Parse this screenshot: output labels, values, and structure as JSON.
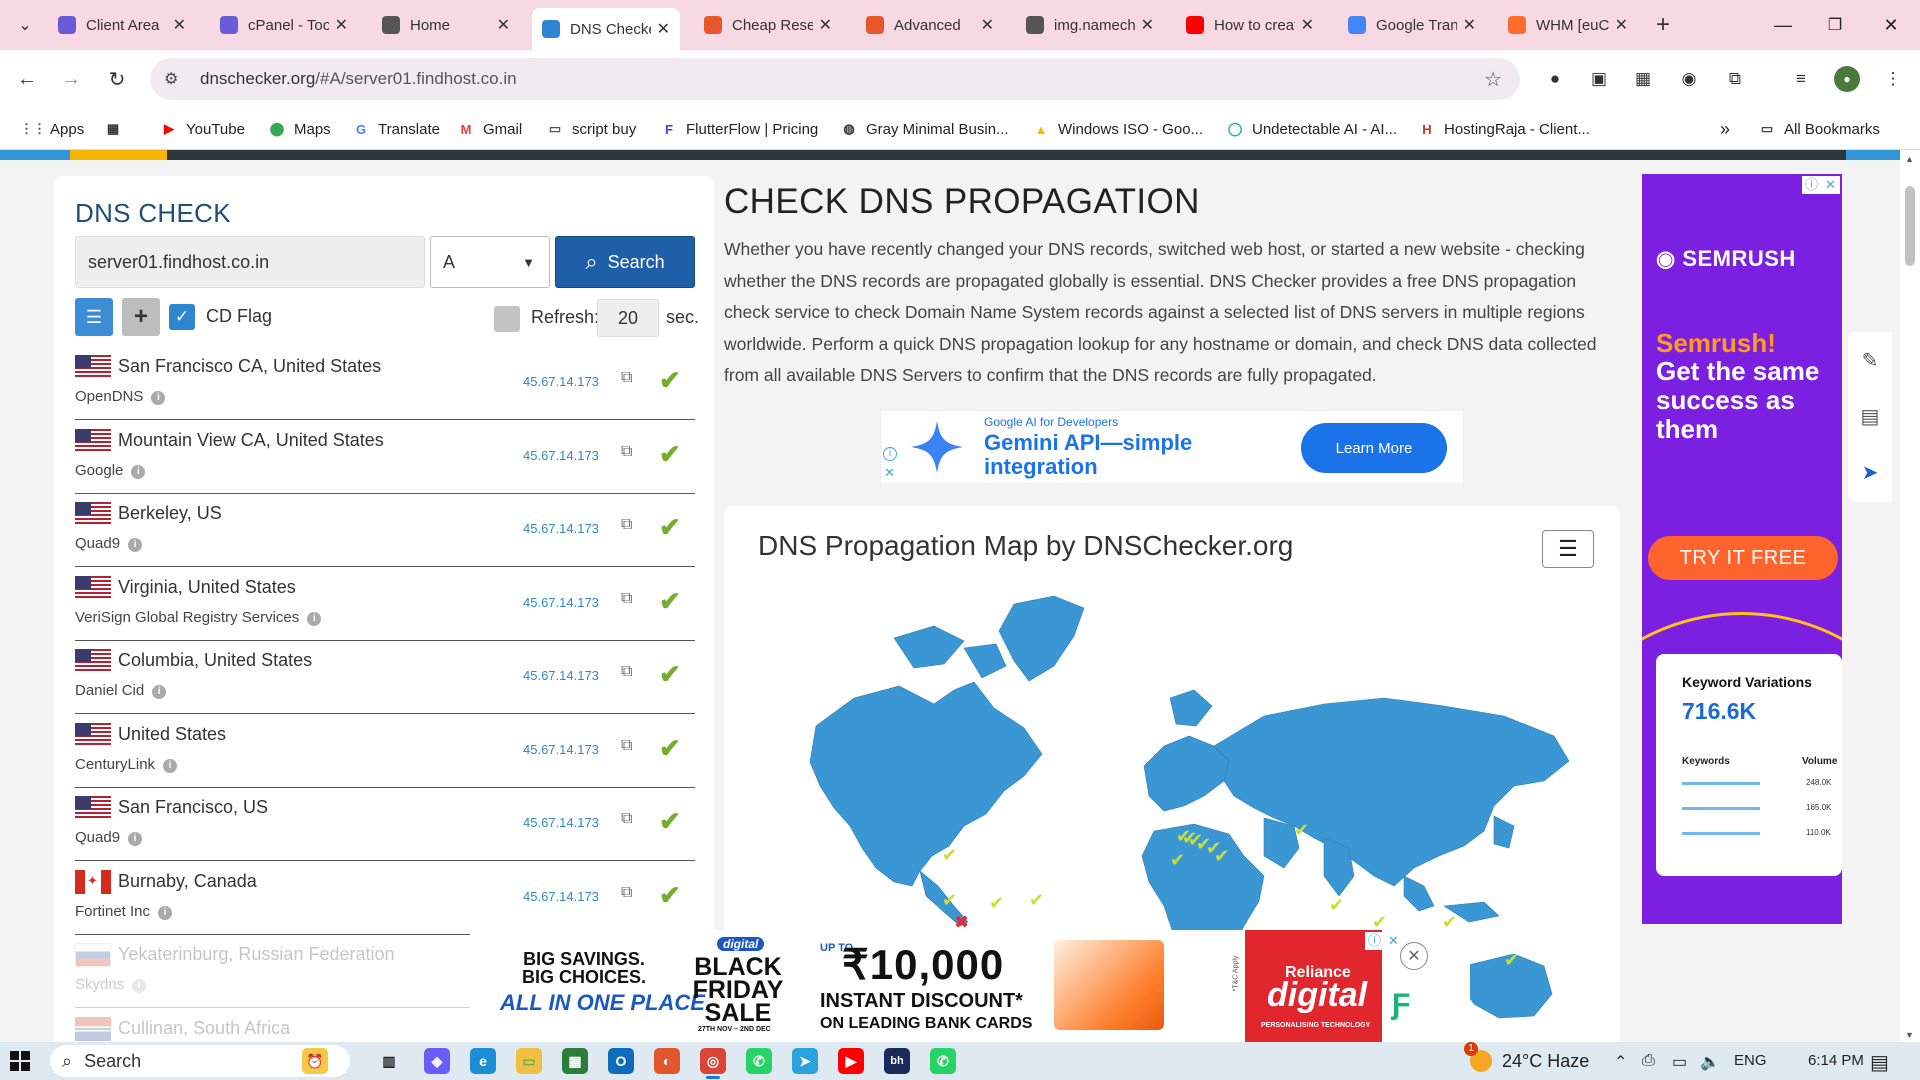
{
  "browser": {
    "tabs": [
      {
        "label": "Client Area",
        "icon": "globe-icon",
        "color": "#6b5bd6",
        "active": false
      },
      {
        "label": "cPanel - Tools",
        "icon": "cpanel-icon",
        "color": "#6b5bd6",
        "active": false
      },
      {
        "label": "Home",
        "icon": "globe-icon",
        "color": "#555555",
        "active": false
      },
      {
        "label": "DNS Checker",
        "icon": "dnschecker-icon",
        "color": "#2f86d0",
        "active": true
      },
      {
        "label": "Cheap Reseller",
        "icon": "namecheap-icon",
        "color": "#e8572a",
        "active": false
      },
      {
        "label": "Advanced",
        "icon": "namecheap-icon",
        "color": "#e8572a",
        "active": false
      },
      {
        "label": "img.namecheap",
        "icon": "globe-icon",
        "color": "#555555",
        "active": false
      },
      {
        "label": "How to create",
        "icon": "youtube-icon",
        "color": "#ff0000",
        "active": false
      },
      {
        "label": "Google Translate",
        "icon": "translate-icon",
        "color": "#4285f4",
        "active": false
      },
      {
        "label": "WHM [euC",
        "icon": "cpanel-icon",
        "color": "#ff6c2c",
        "active": false
      }
    ],
    "new_tab": "+",
    "url_host": "dnschecker.org",
    "url_path": "/#A/server01.findhost.co.in",
    "bookmarks": [
      {
        "label": "Apps",
        "icon": "apps-grid-icon"
      },
      {
        "label": "",
        "icon": "tab-groups-icon"
      },
      {
        "label": "YouTube",
        "icon": "youtube-icon"
      },
      {
        "label": "Maps",
        "icon": "maps-icon"
      },
      {
        "label": "Translate",
        "icon": "translate-icon"
      },
      {
        "label": "Gmail",
        "icon": "gmail-icon"
      },
      {
        "label": "script buy",
        "icon": "folder-icon"
      },
      {
        "label": "FlutterFlow | Pricing",
        "icon": "flutterflow-icon"
      },
      {
        "label": "Gray Minimal Busin...",
        "icon": "globe-icon"
      },
      {
        "label": "Windows ISO - Goo...",
        "icon": "drive-icon"
      },
      {
        "label": "Undetectable AI - AI...",
        "icon": "undetectable-icon"
      },
      {
        "label": "HostingRaja - Client...",
        "icon": "hostingraja-icon"
      }
    ],
    "bookmarks_overflow": "»",
    "all_bookmarks": "All Bookmarks"
  },
  "checker": {
    "title": "DNS CHECK",
    "hostname": "server01.findhost.co.in",
    "record_type": "A",
    "search_label": "Search",
    "cd_flag_label": "CD Flag",
    "cd_flag_checked": true,
    "refresh_label": "Refresh:",
    "refresh_value": "20",
    "refresh_unit": "sec.",
    "results": [
      {
        "location": "San Francisco CA, United States",
        "provider": "OpenDNS",
        "ip": "45.67.14.173",
        "flag": "us",
        "status": "ok"
      },
      {
        "location": "Mountain View CA, United States",
        "provider": "Google",
        "ip": "45.67.14.173",
        "flag": "us",
        "status": "ok"
      },
      {
        "location": "Berkeley, US",
        "provider": "Quad9",
        "ip": "45.67.14.173",
        "flag": "us",
        "status": "ok"
      },
      {
        "location": "Virginia, United States",
        "provider": "VeriSign Global Registry Services",
        "ip": "45.67.14.173",
        "flag": "us",
        "status": "ok"
      },
      {
        "location": "Columbia, United States",
        "provider": "Daniel Cid",
        "ip": "45.67.14.173",
        "flag": "us",
        "status": "ok"
      },
      {
        "location": "United States",
        "provider": "CenturyLink",
        "ip": "45.67.14.173",
        "flag": "us",
        "status": "ok"
      },
      {
        "location": "San Francisco, US",
        "provider": "Quad9",
        "ip": "45.67.14.173",
        "flag": "us",
        "status": "ok"
      },
      {
        "location": "Burnaby, Canada",
        "provider": "Fortinet Inc",
        "ip": "45.67.14.173",
        "flag": "ca",
        "status": "ok"
      },
      {
        "location": "Yekaterinburg, Russian Federation",
        "provider": "Skydns",
        "ip": "",
        "flag": "ru",
        "status": "faded"
      },
      {
        "location": "Cullinan, South Africa",
        "provider": "",
        "ip": "",
        "flag": "za",
        "status": "faded"
      }
    ]
  },
  "content": {
    "heading": "CHECK DNS PROPAGATION",
    "paragraph": "Whether you have recently changed your DNS records, switched web host, or started a new website - checking whether the DNS records are propagated globally is essential. DNS Checker provides a free DNS propagation check service to check Domain Name System records against a selected list of DNS servers in multiple regions worldwide. Perform a quick DNS propagation lookup for any hostname or domain, and check DNS data collected from all available DNS Servers to confirm that the DNS records are fully propagated.",
    "map_title": "DNS Propagation Map by DNSChecker.org"
  },
  "ads": {
    "gemini": {
      "small": "Google AI for Developers",
      "headline": "Gemini API—simple integration",
      "cta": "Learn More"
    },
    "semrush": {
      "brand": "SEMRUSH",
      "head1": "Semrush!",
      "head2": "Get the same success as them",
      "cta": "TRY IT FREE",
      "card_title": "Keyword Variations",
      "card_value": "716.6K",
      "col_keywords": "Keywords",
      "col_volume": "Volume",
      "volumes": [
        "248.0K",
        "165.0K",
        "110.0K"
      ]
    },
    "reliance": {
      "big_savings": "BIG SAVINGS.",
      "big_choices": "BIG CHOICES.",
      "all_in_one": "ALL IN ONE PLACE.",
      "digital_tag": "digital",
      "black": "BLACK",
      "friday": "FRIDAY",
      "sale": "SALE",
      "dates": "27TH NOV – 2ND DEC",
      "upto": "UP TO",
      "amount": "₹10,000",
      "instant": "INSTANT DISCOUNT*",
      "bank": "ON LEADING BANK CARDS",
      "tc": "*T&C Apply",
      "reliance": "Reliance",
      "digital": "digital",
      "tagline": "PERSONALISING TECHNOLOGY"
    },
    "ad_info": "ⓘ",
    "ad_close": "✕"
  },
  "taskbar": {
    "search": "Search",
    "weather_temp": "24°C",
    "weather_text": "Haze",
    "weather_badge": "1",
    "language": "ENG",
    "time": "6:14 PM"
  },
  "colors": {
    "accent_blue": "#1f5fa9",
    "success_green": "#75ad2e",
    "ip_blue": "#2e88c9",
    "map_blue": "#3b97d3",
    "semrush_purple": "#7b1fe0",
    "tabbar_pink": "#f6d9e3"
  }
}
